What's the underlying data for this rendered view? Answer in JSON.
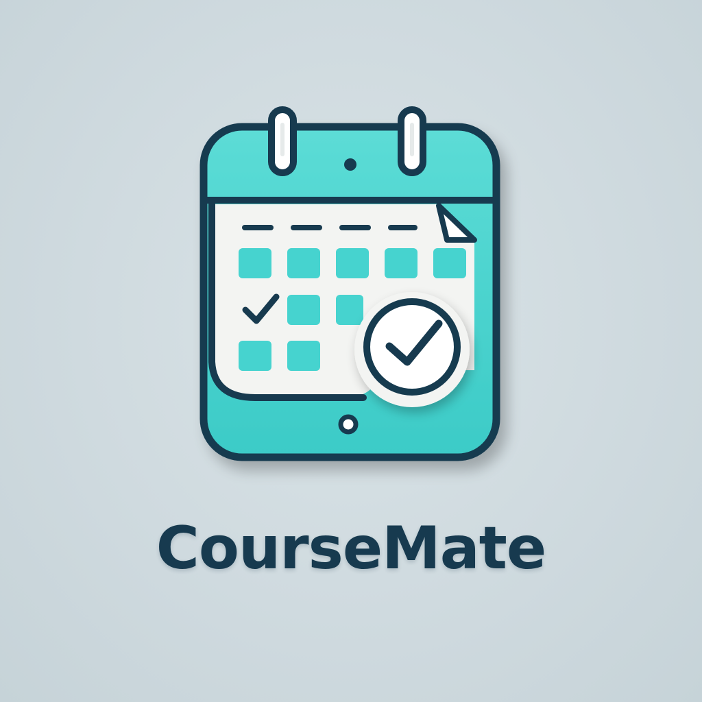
{
  "brand": {
    "name": "CourseMate"
  },
  "icon": {
    "name": "calendar-check-icon"
  },
  "colors": {
    "background": "#cfdadf",
    "accent": "#46d3cf",
    "outline": "#173a4f",
    "paper": "#f3f4f2",
    "text": "#173a4f"
  }
}
